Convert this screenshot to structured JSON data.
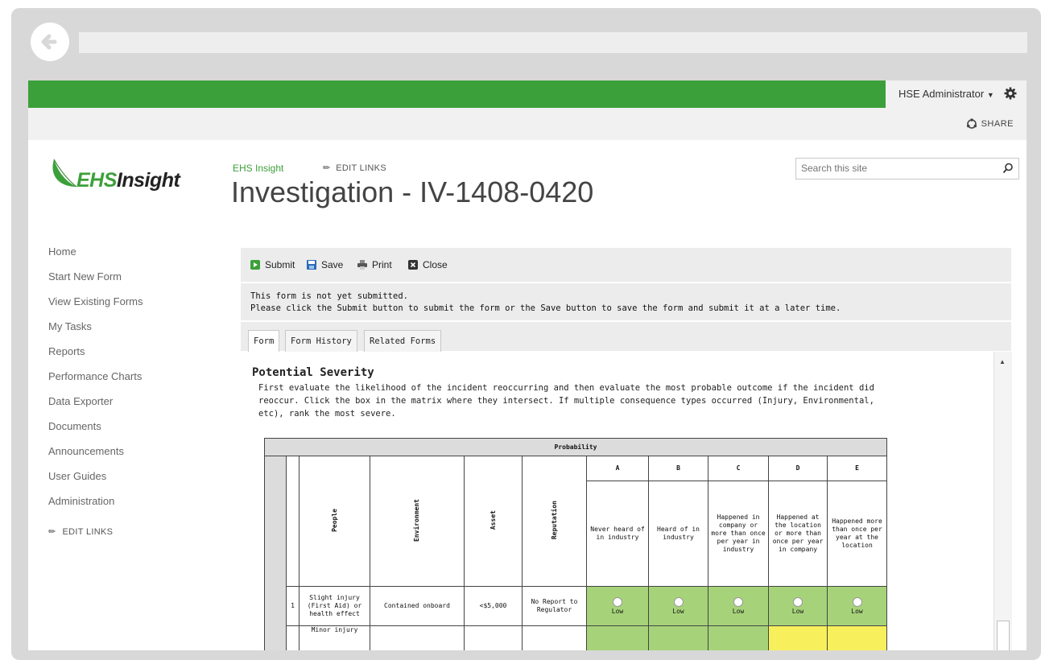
{
  "browser": {
    "address": ""
  },
  "suite_bar": {
    "user": "HSE Administrator",
    "share": "SHARE"
  },
  "logo": {
    "part1": "EHS",
    "part2": "Insight"
  },
  "header": {
    "breadcrumb": "EHS Insight",
    "edit_links": "EDIT LINKS",
    "title": "Investigation - IV-1408-0420",
    "search_placeholder": "Search this site"
  },
  "nav": {
    "items": [
      "Home",
      "Start New Form",
      "View Existing Forms",
      "My Tasks",
      "Reports",
      "Performance Charts",
      "Data Exporter",
      "Documents",
      "Announcements",
      "User Guides",
      "Administration"
    ],
    "edit_links": "EDIT LINKS"
  },
  "toolbar": {
    "submit": "Submit",
    "save": "Save",
    "print": "Print",
    "close": "Close"
  },
  "notice": {
    "line1": "This form is not yet submitted.",
    "line2": "Please click the Submit button to submit the form or the Save button to save the form and submit it at a later time."
  },
  "tabs": [
    "Form",
    "Form History",
    "Related Forms"
  ],
  "form": {
    "section_title": "Potential Severity",
    "instructions_line1": "First evaluate the likelihood of the incident reoccurring and then evaluate the most probable outcome if the incident did",
    "instructions_line2": "reoccur.  Click the box in the matrix where they intersect.  If multiple consequence types occurred (Injury, Environmental,",
    "instructions_line3": "etc), rank the most severe."
  },
  "matrix": {
    "probability_label": "Probability",
    "columns": [
      "People",
      "Environment",
      "Asset",
      "Reputation"
    ],
    "letters": [
      "A",
      "B",
      "C",
      "D",
      "E"
    ],
    "descriptions": [
      "Never heard of in industry",
      "Heard of in industry",
      "Happened in company or more than once per year in industry",
      "Happened at the location or more than once per year in company",
      "Happened more than once per year at the location"
    ],
    "row1": {
      "num": "1",
      "people": "Slight injury (First Aid) or health effect",
      "environment": "Contained onboard",
      "asset": "<$5,000",
      "reputation": "No Report to Regulator",
      "ratings": [
        "Low",
        "Low",
        "Low",
        "Low",
        "Low"
      ]
    },
    "row2": {
      "people": "Minor injury"
    },
    "colors": {
      "low": "#a6d37a",
      "medium": "#f7f05c"
    }
  },
  "colors": {
    "accent": "#3ca03a"
  }
}
